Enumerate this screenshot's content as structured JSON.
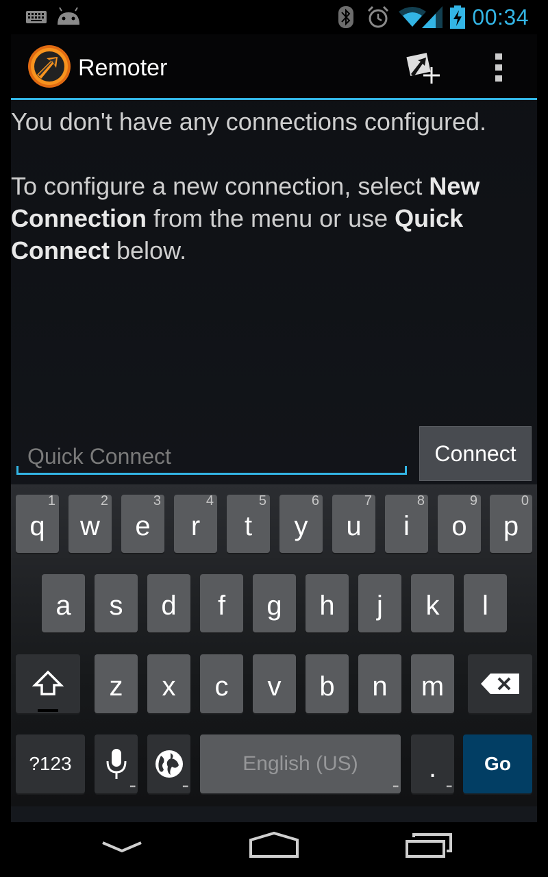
{
  "status_bar": {
    "time": "00:34",
    "icons": [
      "keyboard-icon",
      "android-icon",
      "bluetooth-icon",
      "alarm-icon",
      "wifi-icon",
      "signal-icon",
      "battery-charging-icon"
    ],
    "accent": "#33b5e5"
  },
  "action_bar": {
    "title": "Remoter",
    "icons": [
      "app-logo-icon",
      "new-connection-icon",
      "overflow-menu-icon"
    ]
  },
  "message": {
    "line1": "You don't have any connections configured.",
    "p2_a": "To configure a new connection, select ",
    "p2_b": "New Connection",
    "p2_c": " from the menu or use ",
    "p2_d": "Quick Connect",
    "p2_e": " below."
  },
  "quick_connect": {
    "placeholder": "Quick Connect",
    "value": "",
    "button_label": "Connect"
  },
  "keyboard": {
    "row1": [
      {
        "k": "q",
        "h": "1"
      },
      {
        "k": "w",
        "h": "2"
      },
      {
        "k": "e",
        "h": "3"
      },
      {
        "k": "r",
        "h": "4"
      },
      {
        "k": "t",
        "h": "5"
      },
      {
        "k": "y",
        "h": "6"
      },
      {
        "k": "u",
        "h": "7"
      },
      {
        "k": "i",
        "h": "8"
      },
      {
        "k": "o",
        "h": "9"
      },
      {
        "k": "p",
        "h": "0"
      }
    ],
    "row2": [
      "a",
      "s",
      "d",
      "f",
      "g",
      "h",
      "j",
      "k",
      "l"
    ],
    "row3": [
      "z",
      "x",
      "c",
      "v",
      "b",
      "n",
      "m"
    ],
    "symbols_label": "?123",
    "space_label": "English (US)",
    "period_label": ".",
    "go_label": "Go",
    "icons": [
      "shift-icon",
      "backspace-icon",
      "microphone-icon",
      "globe-icon"
    ],
    "go_color": "#023e64"
  },
  "nav_bar": {
    "icons": [
      "back-down-icon",
      "home-icon",
      "recent-apps-icon"
    ]
  }
}
